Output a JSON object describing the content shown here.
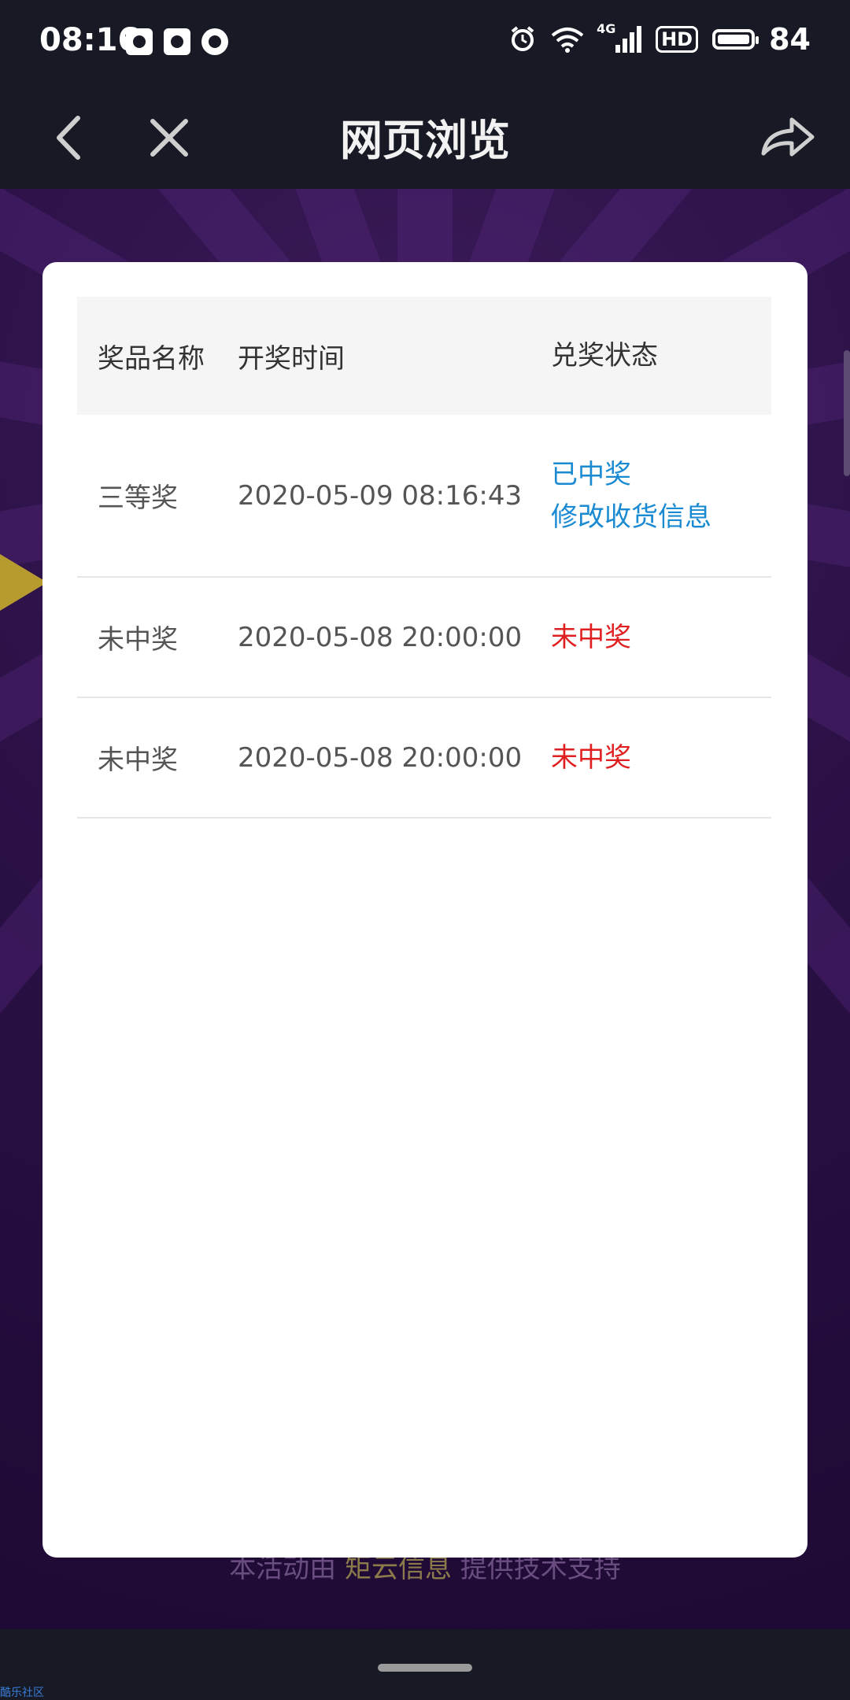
{
  "status_bar": {
    "time": "08:16",
    "network_label": "4G",
    "hd_label": "HD",
    "battery_level": "84"
  },
  "title_bar": {
    "title": "网页浏览"
  },
  "background": {
    "footer_prefix": "本活动由",
    "footer_brand": "矩云信息",
    "footer_suffix": "提供技术支持"
  },
  "modal": {
    "headers": {
      "prize_name": "奖品名称",
      "draw_time": "开奖时间",
      "redeem_status": "兑奖状态"
    },
    "rows": [
      {
        "prize": "三等奖",
        "time": "2020-05-09 08:16:43",
        "status": "已中奖",
        "action": "修改收货信息"
      },
      {
        "prize": "未中奖",
        "time": "2020-05-08 20:00:00",
        "status": "未中奖"
      },
      {
        "prize": "未中奖",
        "time": "2020-05-08 20:00:00",
        "status": "未中奖"
      }
    ]
  },
  "watermark": "酷乐社区",
  "colors": {
    "accent_blue": "#1a8ad2",
    "lose_red": "#e02020",
    "bar_bg": "#171a24"
  }
}
